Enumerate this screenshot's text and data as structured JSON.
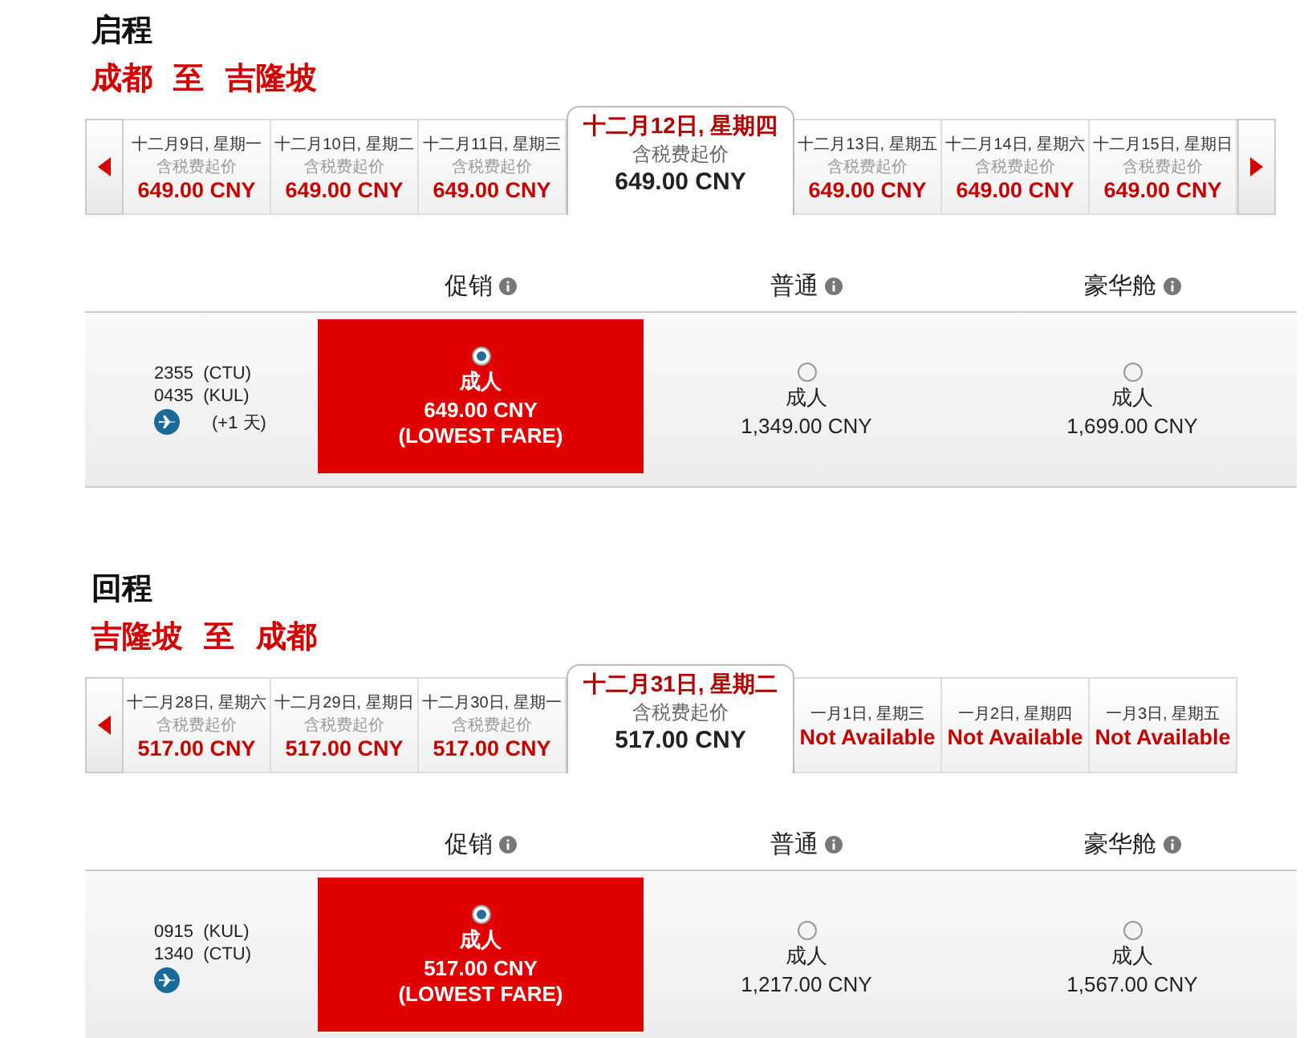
{
  "sections": [
    {
      "title": "启程",
      "route": "成都  至  吉隆坡",
      "has_prev": true,
      "has_next": true,
      "dates": [
        {
          "label": "十二月9日, 星期一",
          "note": "含税费起价",
          "price": "649.00 CNY",
          "selected": false
        },
        {
          "label": "十二月10日, 星期二",
          "note": "含税费起价",
          "price": "649.00 CNY",
          "selected": false
        },
        {
          "label": "十二月11日, 星期三",
          "note": "含税费起价",
          "price": "649.00 CNY",
          "selected": false
        },
        {
          "label": "十二月12日, 星期四",
          "note": "含税费起价",
          "price": "649.00 CNY",
          "selected": true
        },
        {
          "label": "十二月13日, 星期五",
          "note": "含税费起价",
          "price": "649.00 CNY",
          "selected": false
        },
        {
          "label": "十二月14日, 星期六",
          "note": "含税费起价",
          "price": "649.00 CNY",
          "selected": false
        },
        {
          "label": "十二月15日, 星期日",
          "note": "含税费起价",
          "price": "649.00 CNY",
          "selected": false
        }
      ],
      "fare_classes": [
        "促销",
        "普通",
        "豪华舱"
      ],
      "flight": {
        "depart": "2355  (CTU)",
        "arrive": "0435  (KUL)",
        "day_offset": "(+1 天)",
        "fares": [
          {
            "passenger": "成人",
            "price": "649.00 CNY",
            "tag": "(LOWEST FARE)",
            "selected": true
          },
          {
            "passenger": "成人",
            "price": "1,349.00 CNY",
            "selected": false
          },
          {
            "passenger": "成人",
            "price": "1,699.00 CNY",
            "selected": false
          }
        ]
      }
    },
    {
      "title": "回程",
      "route": "吉隆坡  至  成都",
      "has_prev": true,
      "has_next": false,
      "dates": [
        {
          "label": "十二月28日, 星期六",
          "note": "含税费起价",
          "price": "517.00 CNY",
          "selected": false
        },
        {
          "label": "十二月29日, 星期日",
          "note": "含税费起价",
          "price": "517.00 CNY",
          "selected": false
        },
        {
          "label": "十二月30日, 星期一",
          "note": "含税费起价",
          "price": "517.00 CNY",
          "selected": false
        },
        {
          "label": "十二月31日, 星期二",
          "note": "含税费起价",
          "price": "517.00 CNY",
          "selected": true
        },
        {
          "label": "一月1日, 星期三",
          "price": "Not Available",
          "selected": false
        },
        {
          "label": "一月2日, 星期四",
          "price": "Not Available",
          "selected": false
        },
        {
          "label": "一月3日, 星期五",
          "price": "Not Available",
          "selected": false
        }
      ],
      "fare_classes": [
        "促销",
        "普通",
        "豪华舱"
      ],
      "flight": {
        "depart": "0915  (KUL)",
        "arrive": "1340  (CTU)",
        "fares": [
          {
            "passenger": "成人",
            "price": "517.00 CNY",
            "tag": "(LOWEST FARE)",
            "selected": true
          },
          {
            "passenger": "成人",
            "price": "1,217.00 CNY",
            "selected": false
          },
          {
            "passenger": "成人",
            "price": "1,567.00 CNY",
            "selected": false
          }
        ]
      }
    }
  ]
}
